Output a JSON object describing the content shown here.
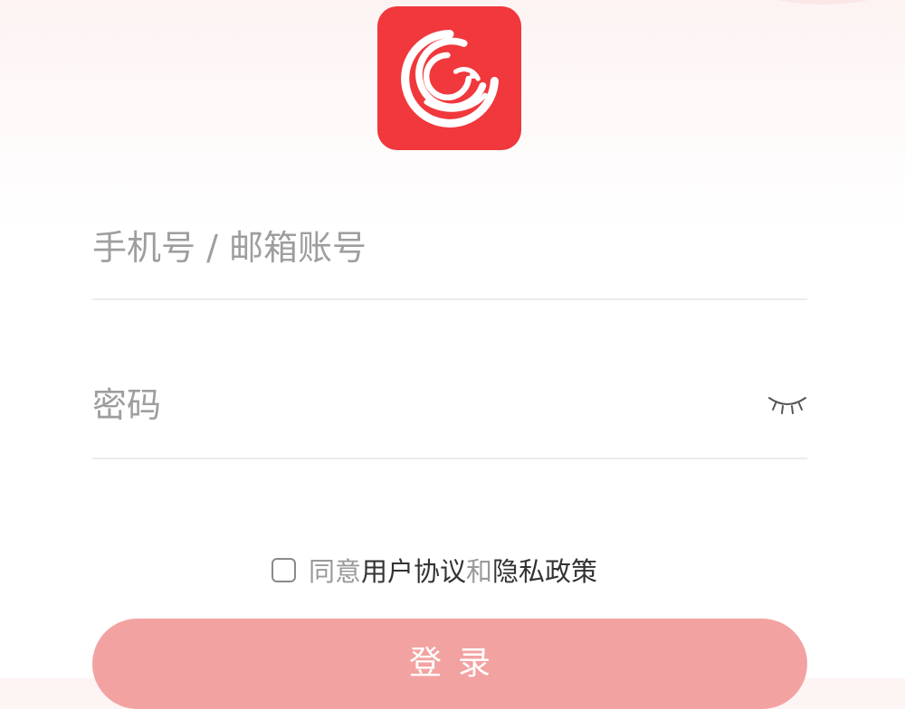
{
  "account": {
    "placeholder": "手机号 / 邮箱账号",
    "value": ""
  },
  "password": {
    "placeholder": "密码",
    "value": "",
    "toggle_icon": "closed-eye-icon"
  },
  "agreement": {
    "prefix": "同意",
    "user_agreement": "用户协议",
    "conjunction": "和",
    "privacy_policy": "隐私政策",
    "checked": false
  },
  "login_button": {
    "label": "登录"
  },
  "colors": {
    "brand": "#f0383d",
    "button": "#f2a3a1"
  }
}
